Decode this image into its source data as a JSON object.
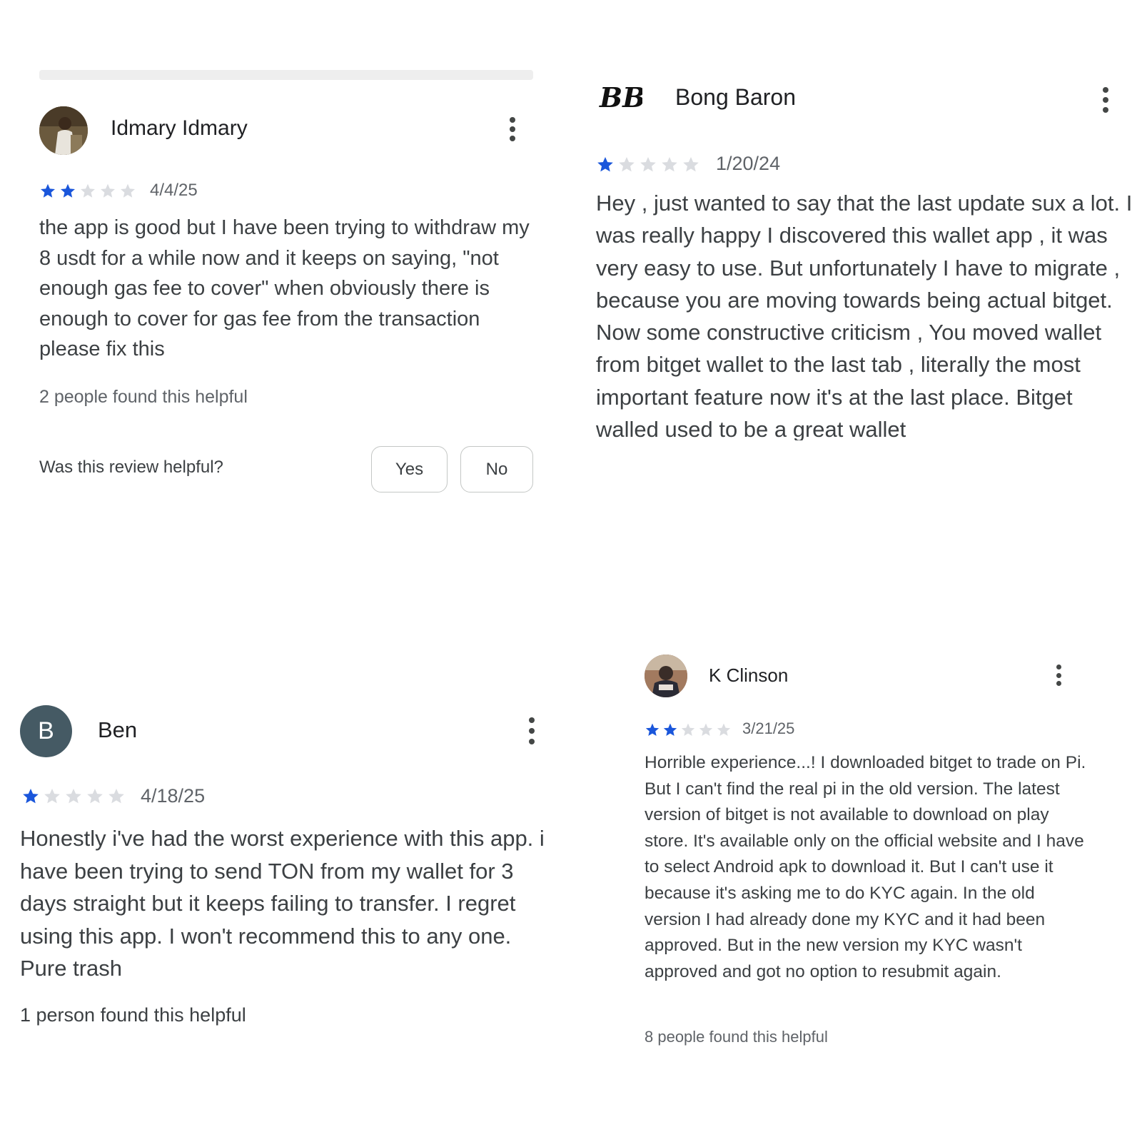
{
  "colors": {
    "star_filled": "#1a56db",
    "star_empty": "#dadce0",
    "text": "#3c4043",
    "secondary": "#5f6368"
  },
  "reviews": [
    {
      "author": "Idmary Idmary",
      "rating": 2,
      "date": "4/4/25",
      "body": "the app is good but I have been trying to withdraw my 8 usdt for a while now and it keeps on saying, \"not enough gas fee to cover\" when obviously there is enough to cover for gas fee from the transaction please fix this",
      "helpful_count_text": "2 people found this helpful",
      "helpful_question": "Was this review helpful?",
      "yes_label": "Yes",
      "no_label": "No"
    },
    {
      "author": "Bong Baron",
      "logo_text": "BB",
      "rating": 1,
      "date": "1/20/24",
      "body": "Hey , just wanted to say that the last update sux a lot. I was really happy I discovered this wallet app , it was very easy to use. But unfortunately I have to migrate , because you are moving towards being actual bitget. Now some constructive criticism , You moved wallet from bitget wallet to the last tab , literally the most important feature now it's at the last place. Bitget walled used to be a great wallet"
    },
    {
      "author": "Ben",
      "avatar_letter": "B",
      "rating": 1,
      "date": "4/18/25",
      "body": "Honestly i've had the worst experience with this app. i have been trying to send TON from my wallet for 3 days straight but it keeps failing to transfer. I regret using this app. I won't recommend this to any one. Pure trash",
      "helpful_count_text": "1 person found this helpful"
    },
    {
      "author": "K Clinson",
      "rating": 2,
      "date": "3/21/25",
      "body": "Horrible experience...! I downloaded bitget to trade on Pi. But I can't find the real pi in the old version. The latest version of bitget is not available to download on play store. It's available only on the official website and I have to select Android apk to download it. But I can't use it because it's asking me to do KYC again. In the old version I had already done my KYC and it had been approved. But in the new version my KYC wasn't approved and got no option to resubmit again.",
      "helpful_count_text": "8 people found this helpful"
    }
  ]
}
